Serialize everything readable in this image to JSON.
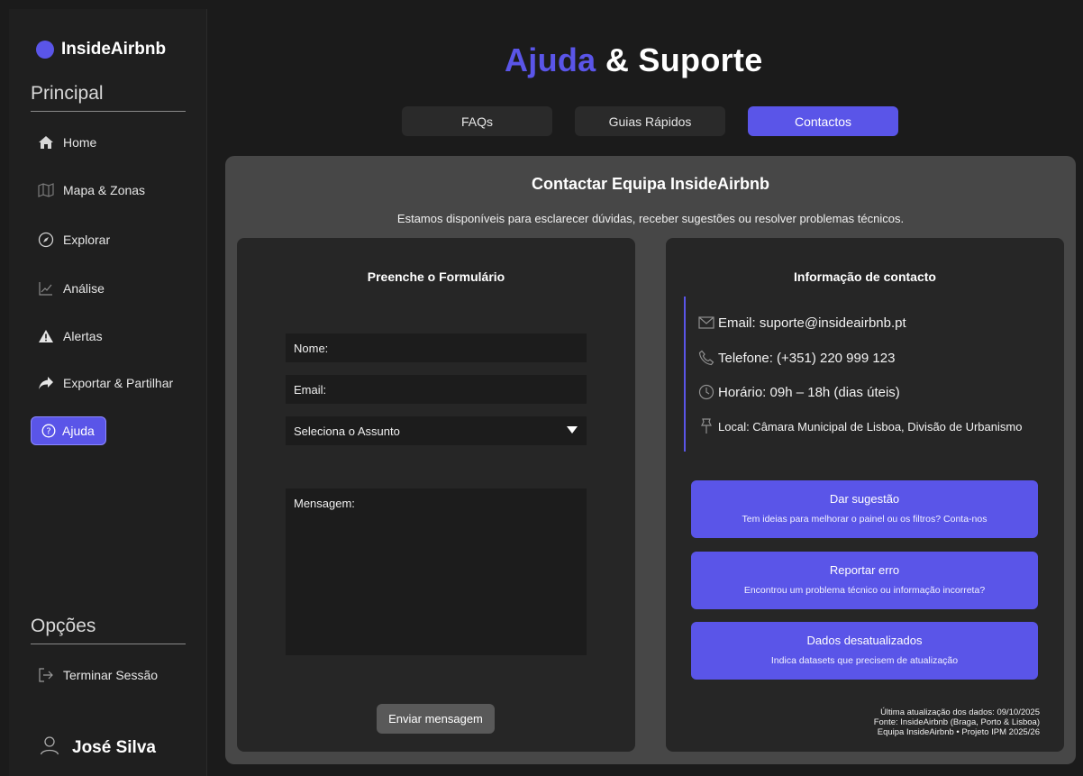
{
  "brand": {
    "name": "InsideAirbnb"
  },
  "sidebar": {
    "principal_title": "Principal",
    "items": [
      {
        "label": "Home",
        "icon": "home-icon"
      },
      {
        "label": "Mapa & Zonas",
        "icon": "map-icon"
      },
      {
        "label": "Explorar",
        "icon": "compass-icon"
      },
      {
        "label": "Análise",
        "icon": "chart-icon"
      },
      {
        "label": "Alertas",
        "icon": "warning-icon"
      },
      {
        "label": "Exportar & Partilhar",
        "icon": "share-icon"
      },
      {
        "label": "Ajuda",
        "icon": "help-icon",
        "active": true
      }
    ],
    "options_title": "Opções",
    "logout_label": "Terminar Sessão",
    "user_name": "José Silva"
  },
  "header": {
    "title_accent": "Ajuda",
    "title_rest": "& Suporte"
  },
  "tabs": [
    {
      "label": "FAQs"
    },
    {
      "label": "Guias Rápidos"
    },
    {
      "label": "Contactos",
      "active": true
    }
  ],
  "contact_panel": {
    "title": "Contactar Equipa InsideAirbnb",
    "subtitle": "Estamos disponíveis para esclarecer dúvidas, receber sugestões ou resolver problemas técnicos."
  },
  "form": {
    "title": "Preenche o Formulário",
    "name_placeholder": "Nome:",
    "email_placeholder": "Email:",
    "subject_selected": "Seleciona o Assunto",
    "message_placeholder": "Mensagem:",
    "submit_label": "Enviar mensagem"
  },
  "info": {
    "title": "Informação de contacto",
    "email": "Email: suporte@insideairbnb.pt",
    "phone": "Telefone: (+351) 220 999 123",
    "hours": "Horário: 09h – 18h (dias úteis)",
    "location": "Local: Câmara Municipal de Lisboa, Divisão de Urbanismo"
  },
  "actions": [
    {
      "title": "Dar sugestão",
      "desc": "Tem ideias para melhorar o painel ou os filtros? Conta-nos"
    },
    {
      "title": "Reportar erro",
      "desc": "Encontrou um problema técnico ou informação incorreta?"
    },
    {
      "title": "Dados desatualizados",
      "desc": "Indica datasets que precisem de atualização"
    }
  ],
  "footer": {
    "updated": "Última atualização dos dados: 09/10/2025",
    "source": "Fonte: InsideAirbnb (Braga, Porto & Lisboa)",
    "team": "Equipa InsideAirbnb • Projeto IPM 2025/26"
  },
  "colors": {
    "accent": "#5a55e8",
    "background": "#1b1b1b",
    "panel": "#474747",
    "card": "#262626"
  }
}
